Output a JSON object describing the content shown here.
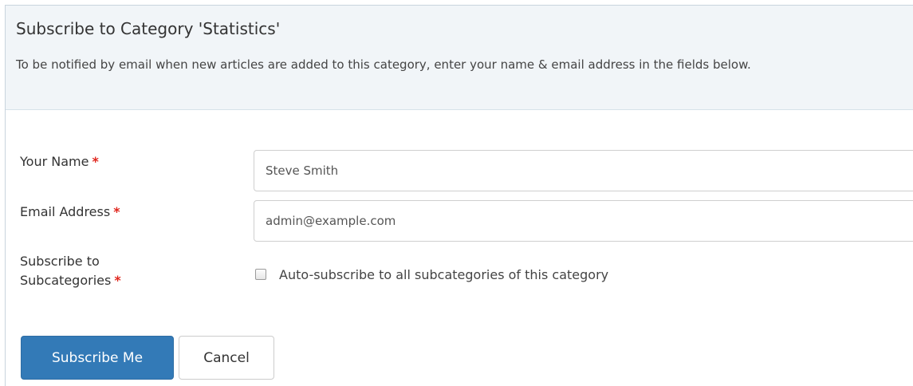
{
  "header": {
    "title": "Subscribe to Category 'Statistics'",
    "description": "To be notified by email when new articles are added to this category, enter your name & email address in the fields below."
  },
  "form": {
    "name": {
      "label": "Your Name",
      "required_mark": "*",
      "value": "Steve Smith"
    },
    "email": {
      "label": "Email Address",
      "required_mark": "*",
      "value": "admin@example.com"
    },
    "subcategories": {
      "label_line1": "Subscribe to",
      "label_line2": "Subcategories",
      "required_mark": "*",
      "checkbox_label": "Auto-subscribe to all subcategories of this category",
      "checked": false
    }
  },
  "actions": {
    "submit_label": "Subscribe Me",
    "cancel_label": "Cancel"
  },
  "colors": {
    "primary": "#337ab7",
    "required": "#e0261d",
    "header_bg": "#f1f5f8"
  }
}
